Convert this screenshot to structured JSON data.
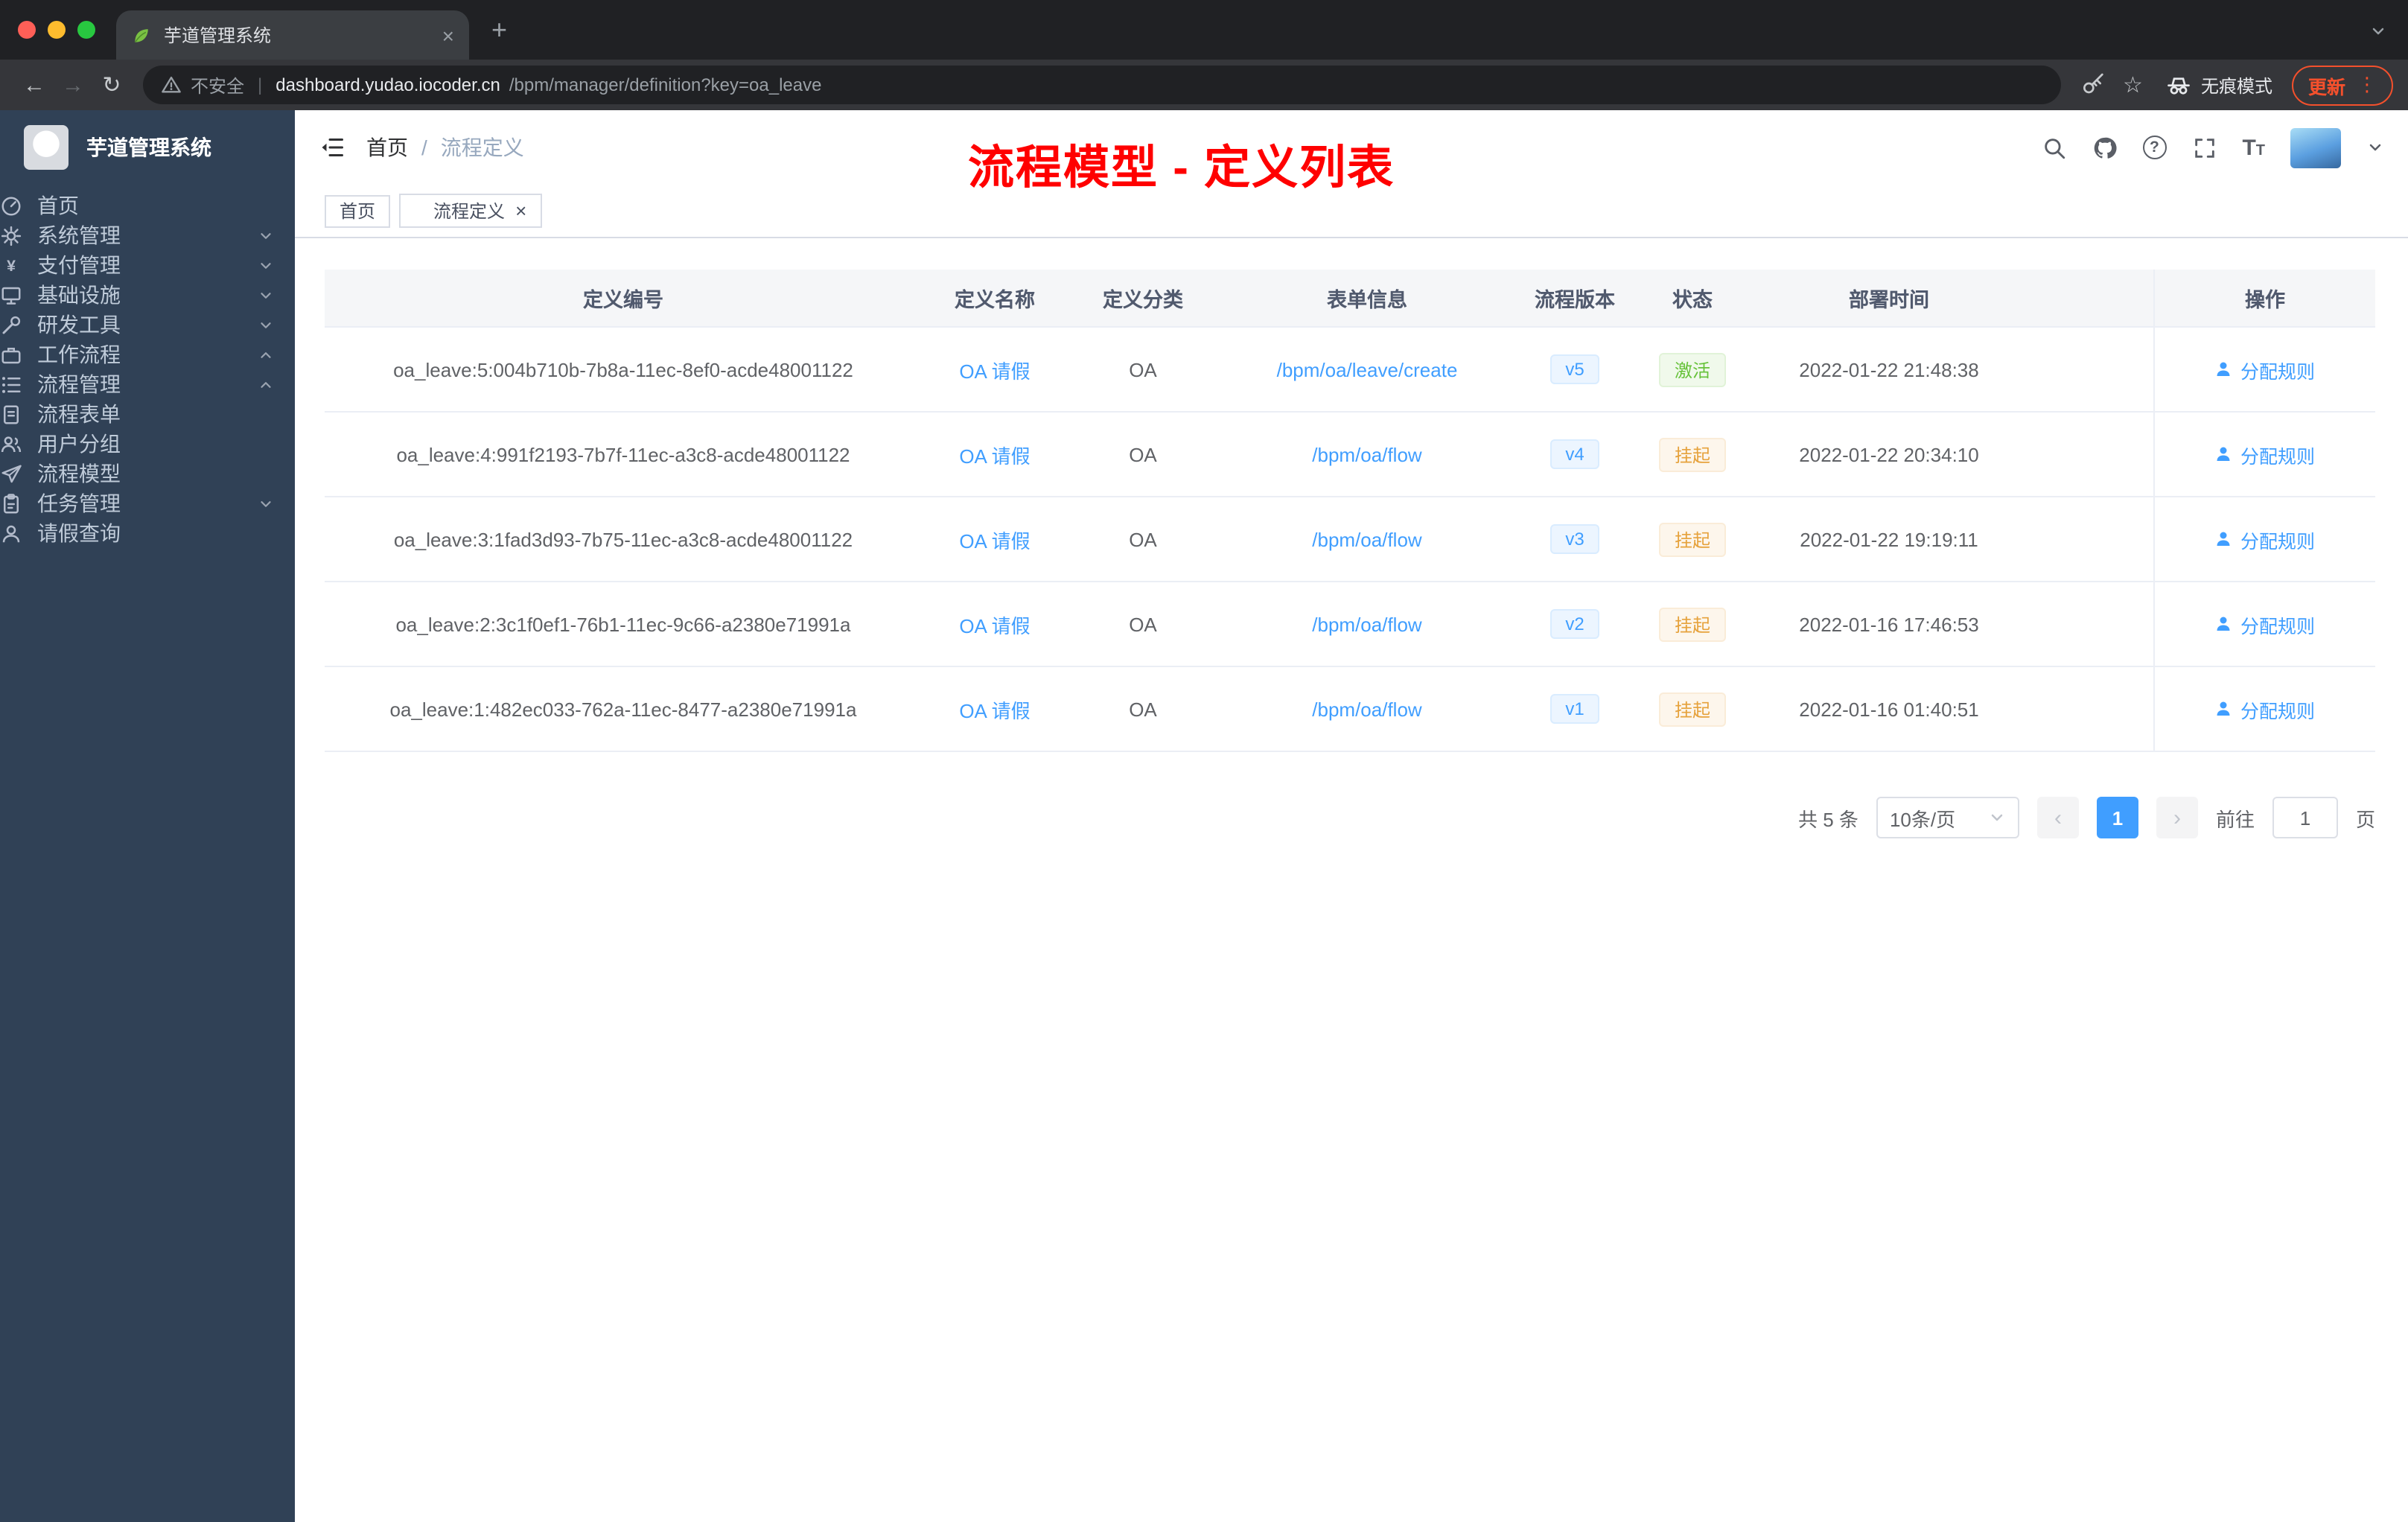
{
  "colors": {
    "accent": "#409eff",
    "success": "#67c23a",
    "warning": "#e6a23c",
    "sidebar_bg": "#304156",
    "submenu_bg": "#1f2d3d",
    "annotation_red": "#ff0000",
    "update_pill": "#f4502c"
  },
  "browser": {
    "tab_title": "芋道管理系统",
    "security_label": "不安全",
    "url_host": "dashboard.yudao.iocoder.cn",
    "url_path": "/bpm/manager/definition?key=oa_leave",
    "incognito_label": "无痕模式",
    "update_label": "更新"
  },
  "icons": {
    "back": "←",
    "forward": "→",
    "reload": "↻",
    "more": "⋮",
    "plus": "+",
    "close": "×",
    "star": "☆",
    "question": "?",
    "divider": "|",
    "prev": "‹",
    "next": "›",
    "font_large": "T",
    "font_small": "T"
  },
  "sidebar": {
    "logo_title": "芋道管理系统",
    "items": [
      {
        "label": "首页",
        "icon": "dashboard-icon",
        "level_class": "lv1"
      },
      {
        "label": "系统管理",
        "icon": "gear-icon",
        "level_class": "lv1",
        "chevron": "down"
      },
      {
        "label": "支付管理",
        "icon": "yen-icon",
        "level_class": "lv1",
        "chevron": "down"
      },
      {
        "label": "基础设施",
        "icon": "monitor-icon",
        "level_class": "lv1",
        "chevron": "down"
      },
      {
        "label": "研发工具",
        "icon": "tools-icon",
        "level_class": "lv1",
        "chevron": "down"
      },
      {
        "label": "工作流程",
        "icon": "briefcase-icon",
        "level_class": "lv1",
        "chevron": "up"
      },
      {
        "label": "流程管理",
        "icon": "list-icon",
        "level_class": "lv2",
        "chevron": "up"
      },
      {
        "label": "流程表单",
        "icon": "document-icon",
        "level_class": "lv3"
      },
      {
        "label": "用户分组",
        "icon": "user-group-icon",
        "level_class": "lv3"
      },
      {
        "label": "流程模型",
        "icon": "send-icon",
        "level_class": "lv3"
      },
      {
        "label": "任务管理",
        "icon": "task-icon",
        "level_class": "lv2",
        "chevron": "down"
      },
      {
        "label": "请假查询",
        "icon": "user-icon",
        "level_class": "lv2"
      }
    ]
  },
  "header": {
    "breadcrumb": {
      "home": "首页",
      "separator": "/",
      "current": "流程定义"
    },
    "annotation": "流程模型 - 定义列表"
  },
  "tags": [
    {
      "label": "首页"
    },
    {
      "label": "流程定义",
      "state": "active",
      "dot": "1",
      "close_glyph": "×"
    }
  ],
  "table": {
    "columns": [
      "定义编号",
      "定义名称",
      "定义分类",
      "表单信息",
      "流程版本",
      "状态",
      "部署时间",
      "操作"
    ],
    "rows": [
      {
        "id": "oa_leave:5:004b710b-7b8a-11ec-8ef0-acde48001122",
        "name": "OA 请假",
        "category": "OA",
        "form": "/bpm/oa/leave/create",
        "version": "v5",
        "status": "激活",
        "status_type": "success",
        "time": "2022-01-22 21:48:38",
        "action": "分配规则"
      },
      {
        "id": "oa_leave:4:991f2193-7b7f-11ec-a3c8-acde48001122",
        "name": "OA 请假",
        "category": "OA",
        "form": "/bpm/oa/flow",
        "version": "v4",
        "status": "挂起",
        "status_type": "warning",
        "time": "2022-01-22 20:34:10",
        "action": "分配规则"
      },
      {
        "id": "oa_leave:3:1fad3d93-7b75-11ec-a3c8-acde48001122",
        "name": "OA 请假",
        "category": "OA",
        "form": "/bpm/oa/flow",
        "version": "v3",
        "status": "挂起",
        "status_type": "warning",
        "time": "2022-01-22 19:19:11",
        "action": "分配规则"
      },
      {
        "id": "oa_leave:2:3c1f0ef1-76b1-11ec-9c66-a2380e71991a",
        "name": "OA 请假",
        "category": "OA",
        "form": "/bpm/oa/flow",
        "version": "v2",
        "status": "挂起",
        "status_type": "warning",
        "time": "2022-01-16 17:46:53",
        "action": "分配规则"
      },
      {
        "id": "oa_leave:1:482ec033-762a-11ec-8477-a2380e71991a",
        "name": "OA 请假",
        "category": "OA",
        "form": "/bpm/oa/flow",
        "version": "v1",
        "status": "挂起",
        "status_type": "warning",
        "time": "2022-01-16 01:40:51",
        "action": "分配规则"
      }
    ]
  },
  "pagination": {
    "total": "共 5 条",
    "page_size": "10条/页",
    "current_page": "1",
    "goto_label": "前往",
    "goto_value": "1",
    "page_unit": "页"
  }
}
